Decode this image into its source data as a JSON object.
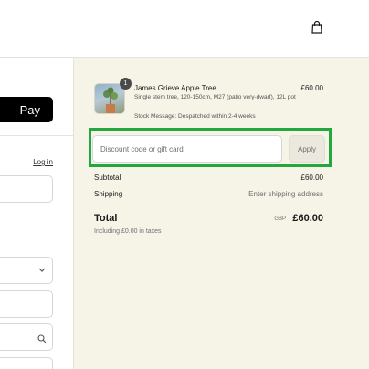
{
  "header": {
    "bag_icon": "shopping-bag-icon"
  },
  "left": {
    "pay_label": "Pay",
    "login_link": "Log in",
    "country_icon": "chevron-down-icon",
    "search_icon": "search-icon"
  },
  "summary": {
    "product": {
      "quantity": "1",
      "name": "James Grieve Apple Tree",
      "price": "£60.00",
      "description": "Single stem tree, 120-150cm, M27 (patio very-dwarf), 12L pot",
      "stock_message": "Stock Message: Despatched within 2-4 weeks"
    },
    "discount": {
      "placeholder": "Discount code or gift card",
      "value": "",
      "apply_label": "Apply"
    },
    "subtotal_label": "Subtotal",
    "subtotal_value": "£60.00",
    "shipping_label": "Shipping",
    "shipping_value": "Enter shipping address",
    "total_label": "Total",
    "total_currency": "GBP",
    "total_value": "£60.00",
    "taxes_note": "Including £0.00 in taxes"
  },
  "colors": {
    "highlight": "#23a840",
    "summary_bg": "#f6f3e7",
    "pay_button": "#000000"
  }
}
